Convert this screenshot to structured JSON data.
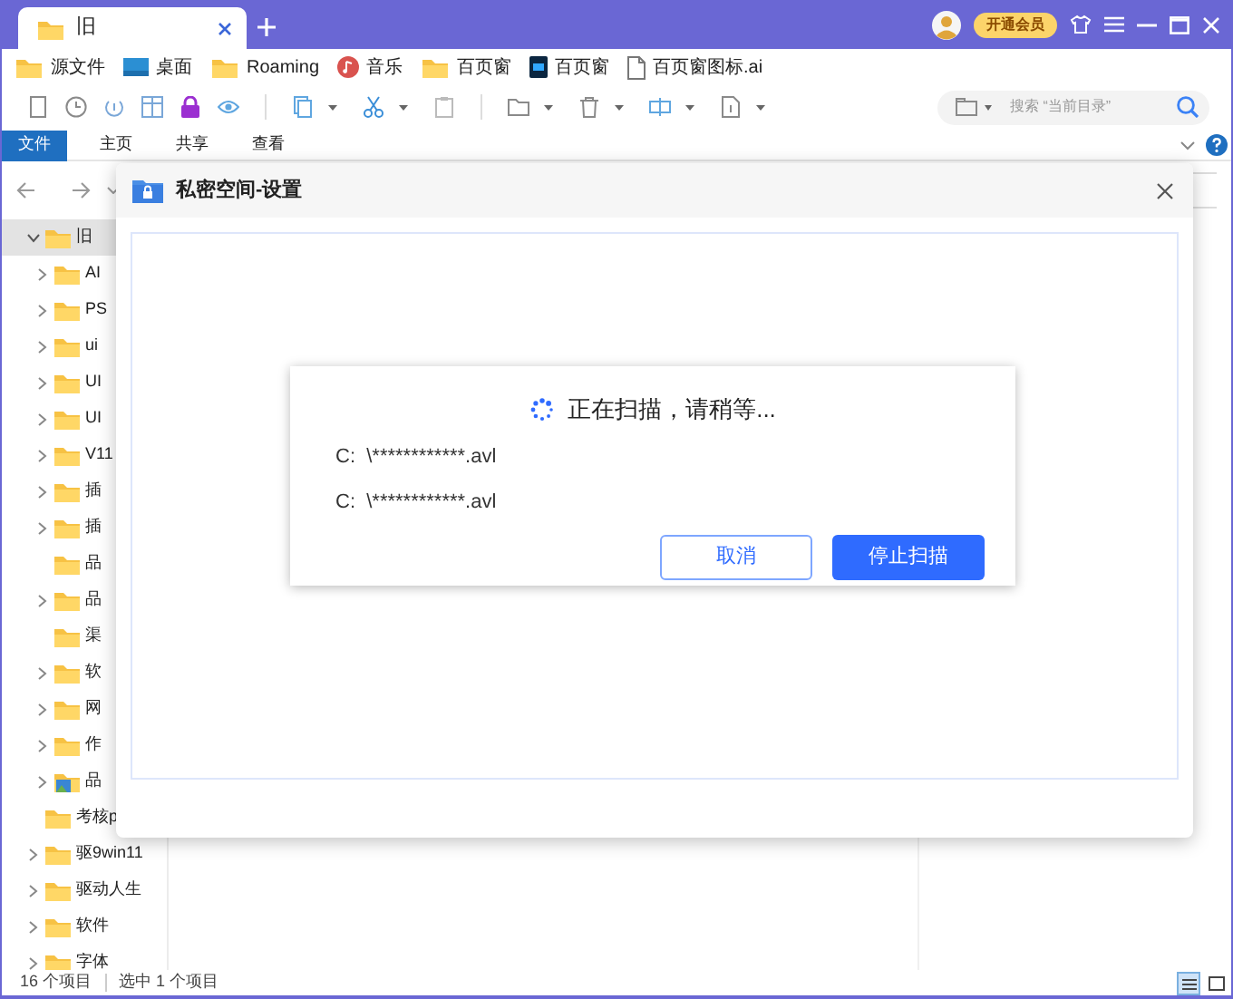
{
  "tabs": [
    {
      "title": "旧",
      "selected": true
    }
  ],
  "titlebar": {
    "vip_label": "开通会员"
  },
  "bookmarks": [
    {
      "label": "源文件",
      "kind": "folder"
    },
    {
      "label": "桌面",
      "kind": "desktop"
    },
    {
      "label": "Roaming",
      "kind": "folder"
    },
    {
      "label": "音乐",
      "kind": "music"
    },
    {
      "label": "百页窗",
      "kind": "folder"
    },
    {
      "label": "百页窗",
      "kind": "ps"
    },
    {
      "label": "百页窗图标.ai",
      "kind": "file"
    }
  ],
  "search": {
    "placeholder": "搜索 “当前目录”"
  },
  "ribbon_tabs": [
    {
      "label": "文件",
      "selected": true
    },
    {
      "label": "主页",
      "selected": false
    },
    {
      "label": "共享",
      "selected": false
    },
    {
      "label": "查看",
      "selected": false
    }
  ],
  "tree": [
    {
      "label": "旧",
      "kind": "folder",
      "expandable": true,
      "expanded": true,
      "selected": true,
      "children": [
        {
          "label": "AI",
          "kind": "folder",
          "expandable": true,
          "expanded": false,
          "selected": false
        },
        {
          "label": "PS",
          "kind": "folder",
          "expandable": true,
          "expanded": false,
          "selected": false
        },
        {
          "label": "ui",
          "kind": "folder",
          "expandable": true,
          "expanded": false,
          "selected": false
        },
        {
          "label": "UI",
          "kind": "folder",
          "expandable": true,
          "expanded": false,
          "selected": false
        },
        {
          "label": "UI",
          "kind": "folder",
          "expandable": true,
          "expanded": false,
          "selected": false
        },
        {
          "label": "V11",
          "kind": "folder",
          "expandable": true,
          "expanded": false,
          "selected": false
        },
        {
          "label": "插",
          "kind": "folder",
          "expandable": true,
          "expanded": false,
          "selected": false
        },
        {
          "label": "插",
          "kind": "folder",
          "expandable": true,
          "expanded": false,
          "selected": false
        },
        {
          "label": "品",
          "kind": "folder",
          "expandable": false,
          "expanded": false,
          "selected": false
        },
        {
          "label": "品",
          "kind": "folder",
          "expandable": true,
          "expanded": false,
          "selected": false
        },
        {
          "label": "渠",
          "kind": "folder",
          "expandable": false,
          "expanded": false,
          "selected": false
        },
        {
          "label": "软",
          "kind": "folder",
          "expandable": true,
          "expanded": false,
          "selected": false
        },
        {
          "label": "网",
          "kind": "folder",
          "expandable": true,
          "expanded": false,
          "selected": false
        },
        {
          "label": "作",
          "kind": "folder",
          "expandable": true,
          "expanded": false,
          "selected": false
        },
        {
          "label": "品",
          "kind": "image-folder",
          "expandable": true,
          "expanded": false,
          "selected": false
        }
      ]
    },
    {
      "label": "考核p",
      "kind": "folder",
      "expandable": false,
      "expanded": false,
      "selected": false
    },
    {
      "label": "驱9win11",
      "kind": "folder",
      "expandable": true,
      "expanded": false,
      "selected": false
    },
    {
      "label": "驱动人生",
      "kind": "folder",
      "expandable": true,
      "expanded": false,
      "selected": false
    },
    {
      "label": "软件",
      "kind": "folder",
      "expandable": true,
      "expanded": false,
      "selected": false
    },
    {
      "label": "字体",
      "kind": "folder",
      "expandable": true,
      "expanded": false,
      "selected": false
    }
  ],
  "dialog": {
    "title": "私密空间-设置"
  },
  "scan": {
    "message": "正在扫描，请稍等...",
    "files": [
      "C:  \\************.avl",
      "C:  \\************.avl"
    ],
    "buttons": [
      {
        "label": "取消",
        "kind": "secondary"
      },
      {
        "label": "停止扫描",
        "kind": "primary"
      }
    ]
  },
  "status_bar": {
    "item_count": "16 个项目",
    "selection": "选中 1 个项目"
  },
  "view_modes": [
    {
      "kind": "details",
      "selected": true
    },
    {
      "kind": "large-icons",
      "selected": false
    }
  ]
}
